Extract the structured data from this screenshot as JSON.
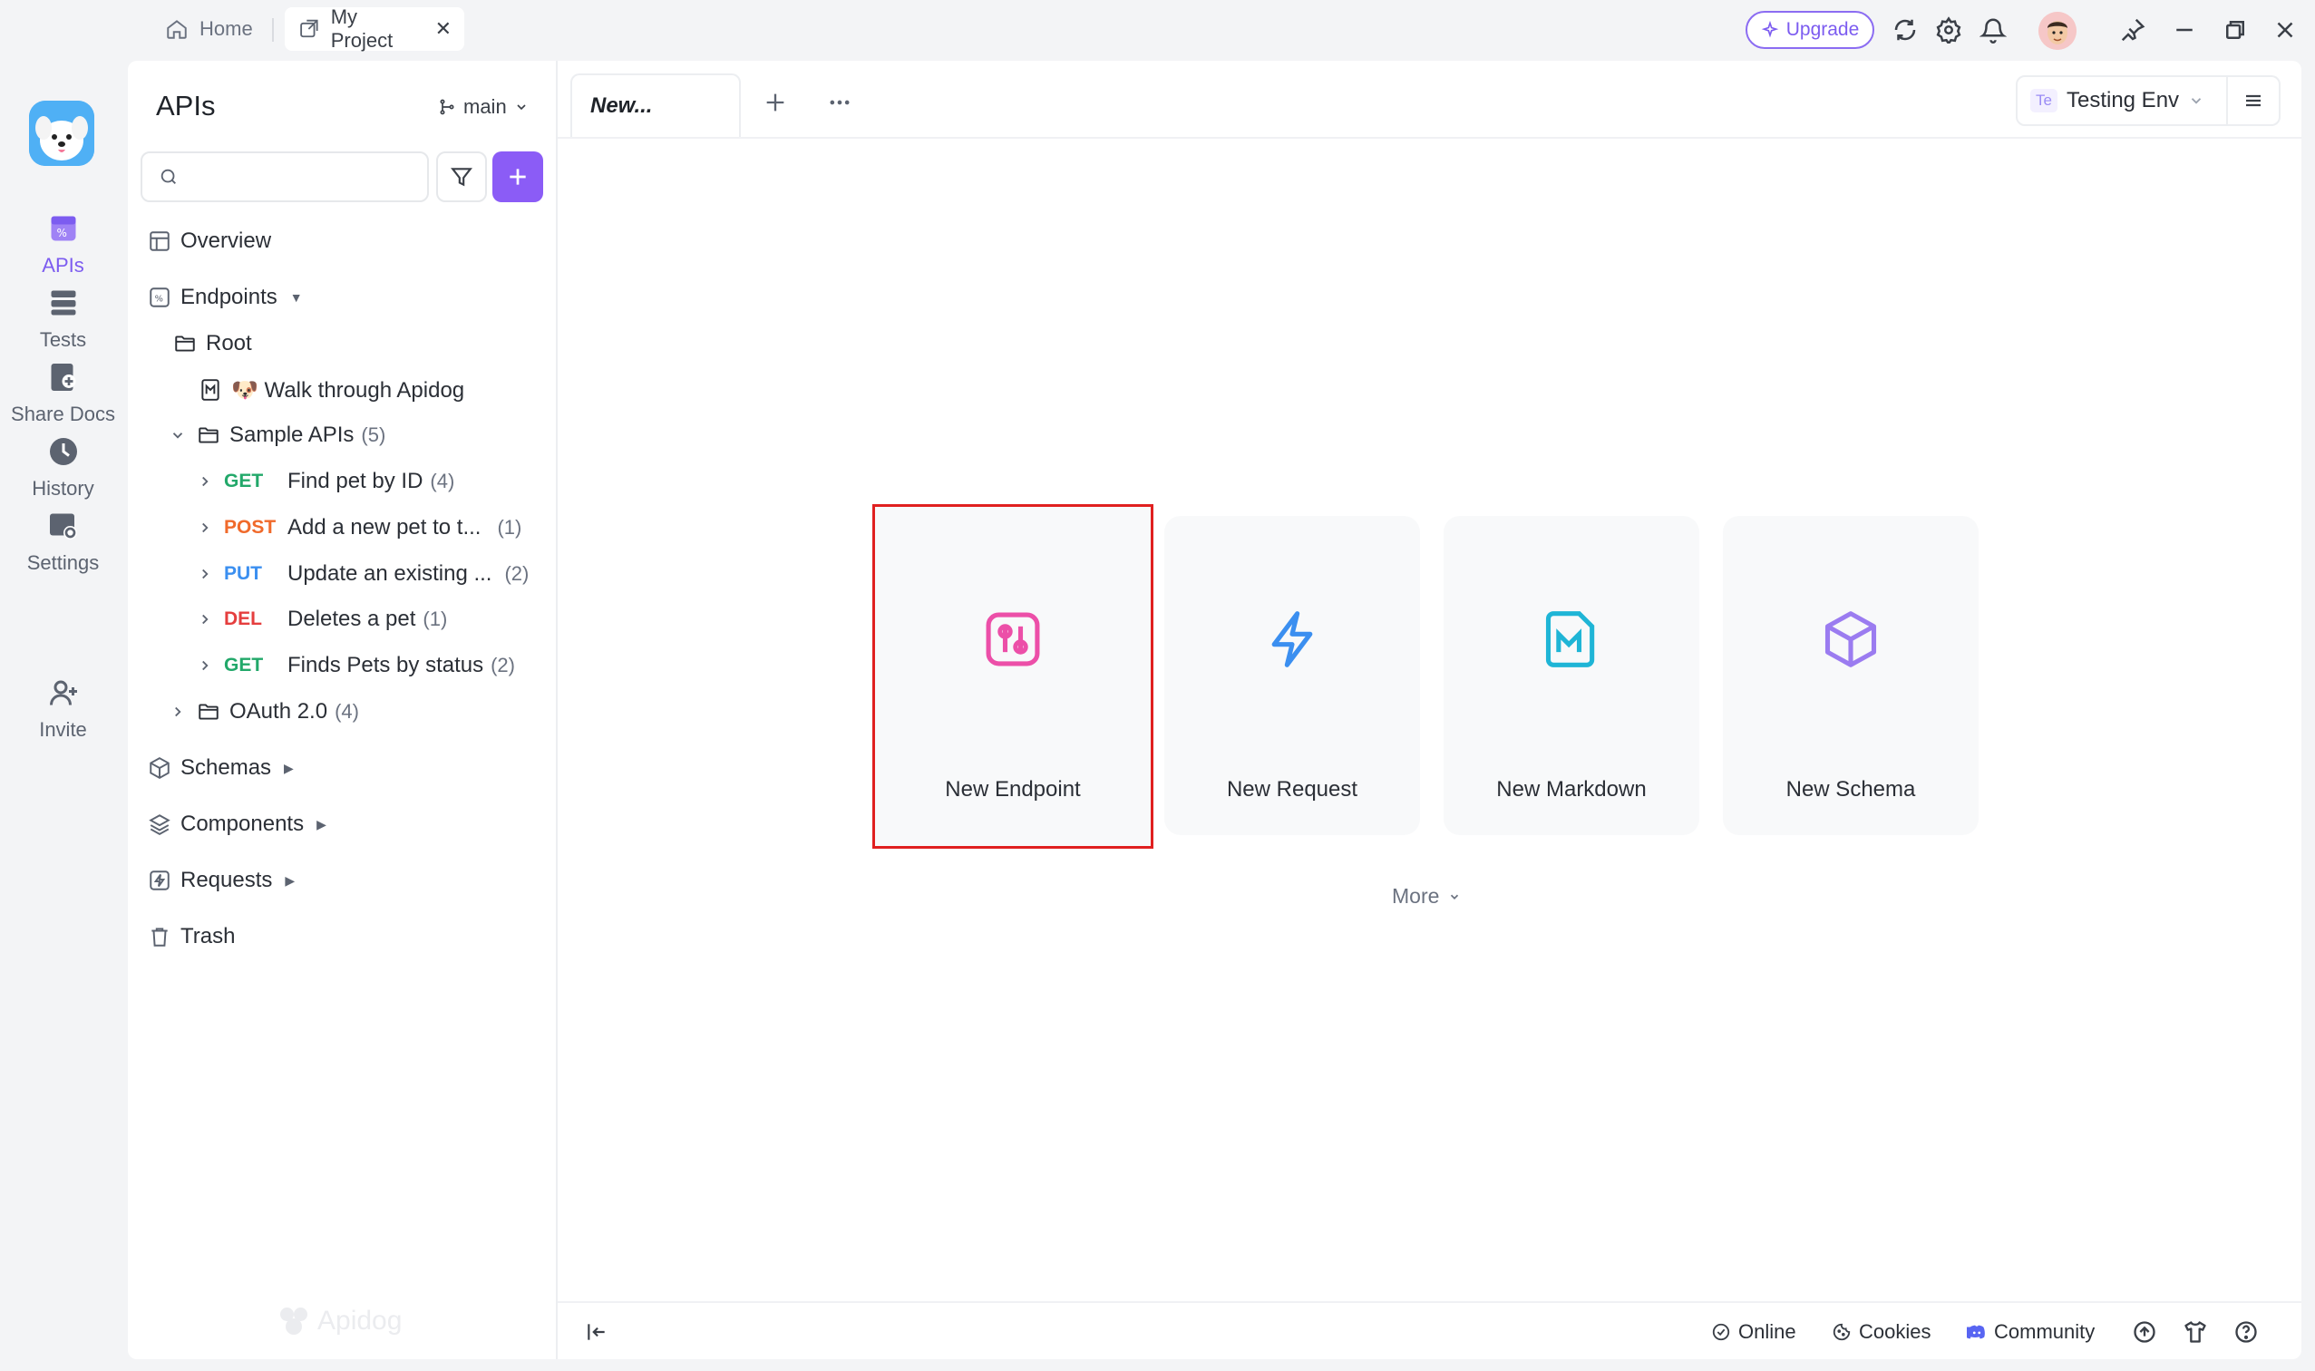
{
  "titlebar": {
    "tabs": [
      {
        "label": "Home",
        "icon": "home-icon"
      },
      {
        "label": "My Project",
        "icon": "project-icon",
        "close": "✕"
      }
    ],
    "upgrade_label": "Upgrade"
  },
  "rail": {
    "items": [
      {
        "label": "APIs",
        "icon": "apis-icon",
        "active": true
      },
      {
        "label": "Tests",
        "icon": "tests-icon"
      },
      {
        "label": "Share Docs",
        "icon": "share-docs-icon"
      },
      {
        "label": "History",
        "icon": "history-icon"
      },
      {
        "label": "Settings",
        "icon": "settings-icon"
      },
      {
        "label": "Invite",
        "icon": "invite-icon"
      }
    ]
  },
  "sidebar": {
    "title": "APIs",
    "branch": "main",
    "search_placeholder": "",
    "overview": "Overview",
    "endpoints": "Endpoints",
    "root": "Root",
    "walkthrough": "🐶 Walk through Apidog",
    "sample_folder": {
      "label": "Sample APIs",
      "count": "(5)"
    },
    "apis": [
      {
        "method": "GET",
        "name": "Find pet by ID",
        "count": "(4)"
      },
      {
        "method": "POST",
        "name": "Add a new pet to t...",
        "count": "(1)"
      },
      {
        "method": "PUT",
        "name": "Update an existing ...",
        "count": "(2)"
      },
      {
        "method": "DEL",
        "name": "Deletes a pet",
        "count": "(1)"
      },
      {
        "method": "GET",
        "name": "Finds Pets by status",
        "count": "(2)"
      }
    ],
    "oauth_folder": {
      "label": "OAuth 2.0",
      "count": "(4)"
    },
    "schemas": "Schemas",
    "components": "Components",
    "requests": "Requests",
    "trash": "Trash",
    "watermark": "Apidog"
  },
  "main": {
    "tab_label": "New...",
    "env_badge": "Te",
    "env_label": "Testing Env",
    "cards": [
      {
        "label": "New Endpoint",
        "icon": "endpoint-icon",
        "color": "#ec4fa8"
      },
      {
        "label": "New Request",
        "icon": "lightning-icon",
        "color": "#3b8ff0"
      },
      {
        "label": "New Markdown",
        "icon": "markdown-icon",
        "color": "#1fb5d6"
      },
      {
        "label": "New Schema",
        "icon": "cube-icon",
        "color": "#9b7cf0"
      }
    ],
    "more_label": "More"
  },
  "statusbar": {
    "online": "Online",
    "cookies": "Cookies",
    "community": "Community"
  },
  "colors": {
    "accent": "#8b5cf6",
    "get": "#22a86a",
    "post": "#f06a2b",
    "put": "#3b8ff0",
    "del": "#e53e3e",
    "highlight_border": "#e02020"
  }
}
